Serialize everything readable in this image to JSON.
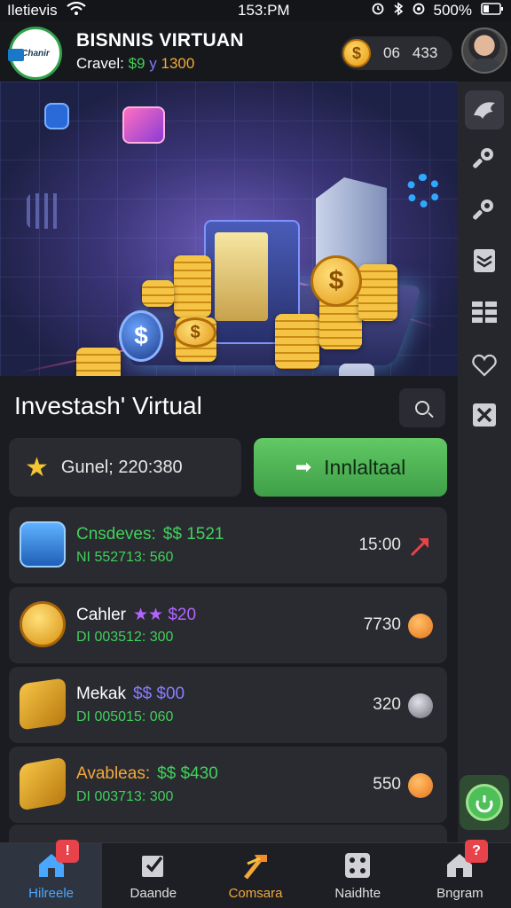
{
  "status_bar": {
    "carrier": "Iletievis",
    "time": "153:PM",
    "battery": "500%"
  },
  "header": {
    "logo_text": "Chanir",
    "title": "BISNNIS VIRTUAN",
    "subtitle_label": "Cravel:",
    "subtitle_money": "$9",
    "subtitle_sep": "y",
    "subtitle_value": "1300",
    "coin_symbol": "$",
    "coin_value_a": "06",
    "coin_value_b": "433"
  },
  "hero": {
    "coin_symbol": "$"
  },
  "main": {
    "section_title": "Investash' Virtual",
    "level_text": "Gunel; 220:380",
    "install_label": "Innlaltaal"
  },
  "assets": [
    {
      "name": "Cnsdeves:",
      "price": "$$ 1521",
      "sub": "NI 552713: 560",
      "value": "15:00",
      "name_color": "#3fd15a",
      "price_color": "#3fd15a",
      "sub_color": "#3fd15a",
      "status_icon": "arrow-up-right-icon"
    },
    {
      "name": "Cahler",
      "price": "★★ $20",
      "sub": "DI 003512: 300",
      "value": "7730",
      "name_color": "#ffffff",
      "price_color": "#b264ff",
      "sub_color": "#3fd15a",
      "status_icon": "orange-dot-icon"
    },
    {
      "name": "Mekak",
      "price": "$$ $00",
      "sub": "DI 005015: 060",
      "value": "320",
      "name_color": "#ffffff",
      "price_color": "#8b7cff",
      "sub_color": "#3fd15a",
      "status_icon": "silver-dot-icon"
    },
    {
      "name": "Avableas:",
      "price": "$$ $430",
      "sub": "DI 003713: 300",
      "value": "550",
      "name_color": "#f2a93b",
      "price_color": "#3fd15a",
      "sub_color": "#3fd15a",
      "status_icon": "orange-dot-icon"
    }
  ],
  "nav": [
    {
      "label": "Hilreele",
      "icon": "home-icon",
      "badge": "!"
    },
    {
      "label": "Daande",
      "icon": "checklist-icon",
      "badge": ""
    },
    {
      "label": "Comsara",
      "icon": "hammer-icon",
      "badge": ""
    },
    {
      "label": "Naidhte",
      "icon": "dice-icon",
      "badge": ""
    },
    {
      "label": "Bngram",
      "icon": "house-icon",
      "badge": "?"
    }
  ],
  "colors": {
    "accent_green": "#4fbf5a",
    "accent_gold": "#f5c445",
    "background": "#1b1c21",
    "active_tab": "#4aa7ff"
  }
}
